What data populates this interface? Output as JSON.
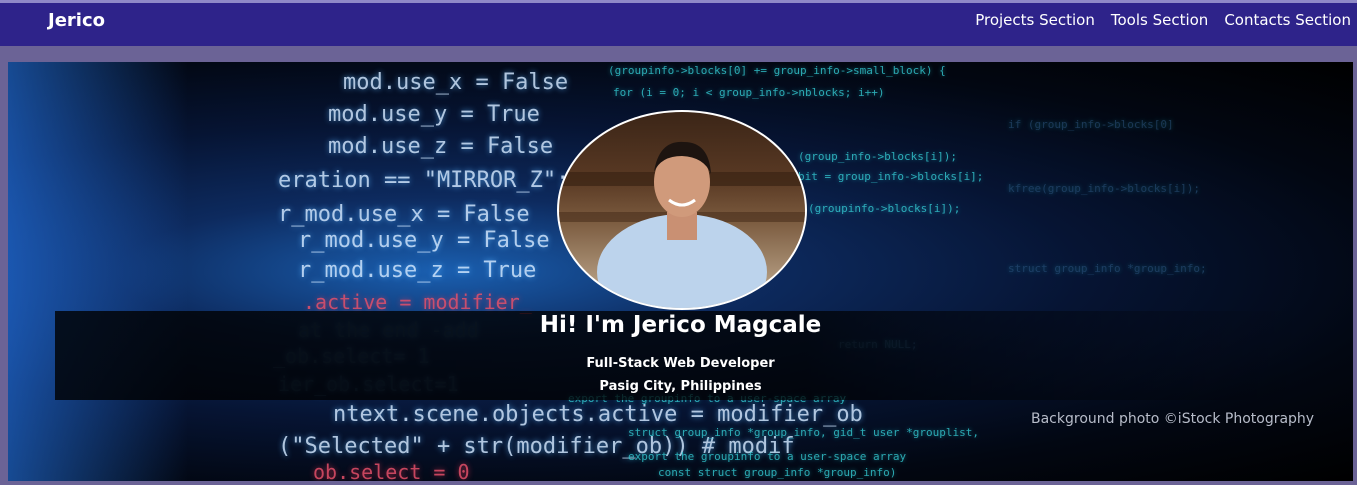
{
  "nav": {
    "brand": "Jerico",
    "links": [
      {
        "label": "Projects Section"
      },
      {
        "label": "Tools Section"
      },
      {
        "label": "Contacts Section"
      }
    ]
  },
  "hero": {
    "title": "Hi! I'm Jerico Magcale",
    "role": "Full-Stack Web Developer",
    "location": "Pasig City, Philippines",
    "photo_credit": "Background photo ©iStock Photography"
  },
  "colors": {
    "navbar": "#2e238a",
    "page_background": "#6b6396",
    "text": "#ffffff",
    "credit_text": "#b7bcc9"
  }
}
